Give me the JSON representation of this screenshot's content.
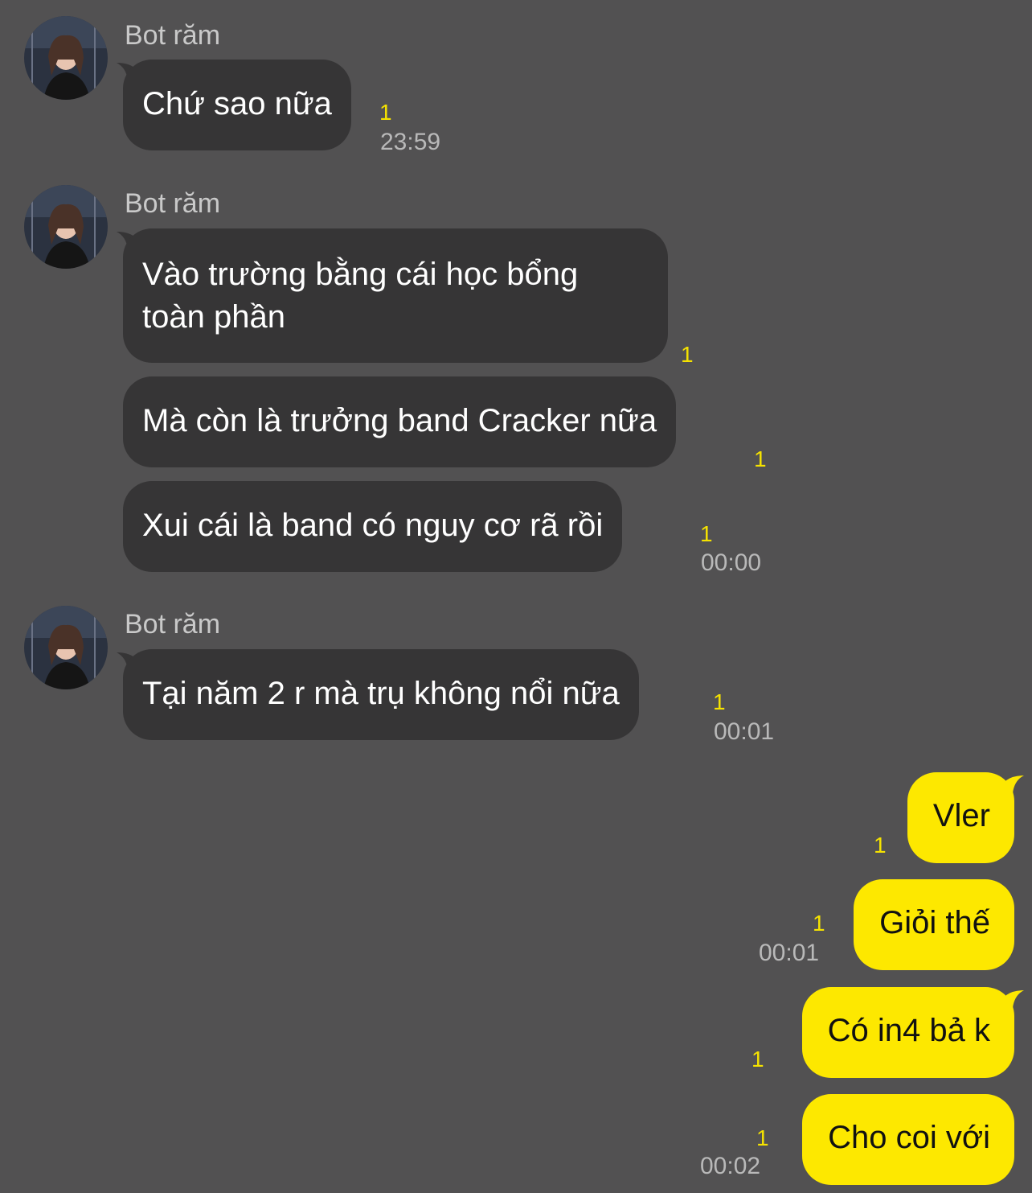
{
  "theme": {
    "background": "#525152",
    "incoming_bubble": "#363536",
    "outgoing_bubble": "#fde800",
    "unread_color": "#f5e200"
  },
  "groups": [
    {
      "sender": "Bot răm",
      "messages": [
        {
          "text": "Chứ sao nữa",
          "unread": "1",
          "time": "23:59"
        }
      ]
    },
    {
      "sender": "Bot răm",
      "messages": [
        {
          "text_lines": [
            "Vào trường bằng cái học bổng",
            "toàn phần"
          ],
          "unread": "1"
        },
        {
          "text": "Mà còn là trưởng band Cracker nữa",
          "unread": "1"
        },
        {
          "text": "Xui cái là band có nguy cơ rã rồi",
          "unread": "1",
          "time": "00:00"
        }
      ]
    },
    {
      "sender": "Bot răm",
      "messages": [
        {
          "text": "Tại năm 2 r mà trụ không nổi nữa",
          "unread": "1",
          "time": "00:01"
        }
      ]
    }
  ],
  "outgoing": [
    {
      "text": "Vler",
      "unread": "1"
    },
    {
      "text": "Giỏi thế",
      "unread": "1",
      "time": "00:01"
    },
    {
      "text": "Có in4 bả k",
      "unread": "1"
    },
    {
      "text": "Cho coi với",
      "unread": "1",
      "time": "00:02"
    }
  ]
}
